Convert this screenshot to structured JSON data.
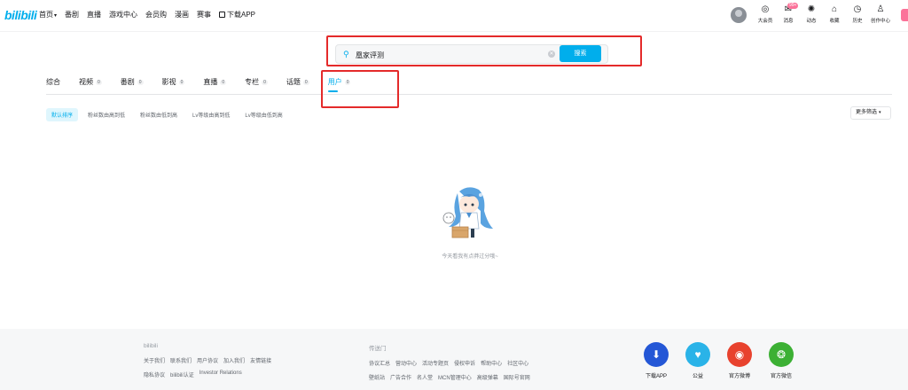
{
  "nav": {
    "logo": "bilibili",
    "left_items": [
      "首页",
      "番剧",
      "直播",
      "游戏中心",
      "会员购",
      "漫画",
      "赛事"
    ],
    "download_app": "下载APP",
    "right_items": [
      {
        "label": "大会员",
        "icon": "vip-icon",
        "glyph": "◎"
      },
      {
        "label": "消息",
        "icon": "message-icon",
        "glyph": "✉",
        "badge": "99+"
      },
      {
        "label": "动态",
        "icon": "dynamic-icon",
        "glyph": "✺"
      },
      {
        "label": "收藏",
        "icon": "favorite-icon",
        "glyph": "⌂"
      },
      {
        "label": "历史",
        "icon": "history-icon",
        "glyph": "◷"
      },
      {
        "label": "创作中心",
        "icon": "creator-icon",
        "glyph": "♙"
      }
    ]
  },
  "search": {
    "value": "凰家评测",
    "button": "搜索"
  },
  "tabs": [
    {
      "label": "综合",
      "count": ""
    },
    {
      "label": "视频",
      "count": "0"
    },
    {
      "label": "番剧",
      "count": "0"
    },
    {
      "label": "影视",
      "count": "0"
    },
    {
      "label": "直播",
      "count": "0"
    },
    {
      "label": "专栏",
      "count": "0"
    },
    {
      "label": "话题",
      "count": "0"
    },
    {
      "label": "用户",
      "count": "0",
      "active": true
    }
  ],
  "sorts": [
    {
      "label": "默认排序",
      "active": true
    },
    {
      "label": "粉丝数由高到低"
    },
    {
      "label": "粉丝数由低到高"
    },
    {
      "label": "Lv等级由高到低"
    },
    {
      "label": "Lv等级由低到高"
    }
  ],
  "more_filter": "更多筛选",
  "empty": {
    "text": "今天看我有点莽过分哦~"
  },
  "footer": {
    "col1_title": "bilibili",
    "col1_row1": [
      "关于我们",
      "联系我们",
      "用户协议",
      "加入我们",
      "友情链接"
    ],
    "col1_row2": [
      "隐私协议",
      "bilibili认证",
      "Investor Relations"
    ],
    "col2_title": "传送门",
    "col2_row1": [
      "协议汇总",
      "营动中心",
      "活动专题页",
      "侵权申诉",
      "帮助中心",
      "社区中心"
    ],
    "col2_row2": [
      "壁纸站",
      "广告合作",
      "名人堂",
      "MCN管理中心",
      "高级弹幕",
      "国际号官网"
    ],
    "apps": [
      {
        "label": "下载APP",
        "icon": "download-app-icon",
        "color": "#2457d6",
        "glyph": "⬇"
      },
      {
        "label": "公益",
        "icon": "charity-icon",
        "color": "#2ab3e8",
        "glyph": "♥"
      },
      {
        "label": "官方微博",
        "icon": "weibo-icon",
        "color": "#e8422e",
        "glyph": "◉"
      },
      {
        "label": "官方微信",
        "icon": "wechat-icon",
        "color": "#3cb034",
        "glyph": "❂"
      }
    ]
  },
  "colors": {
    "accent": "#00aeec",
    "pink": "#fb7299",
    "annotation_red": "#e42a2a"
  }
}
